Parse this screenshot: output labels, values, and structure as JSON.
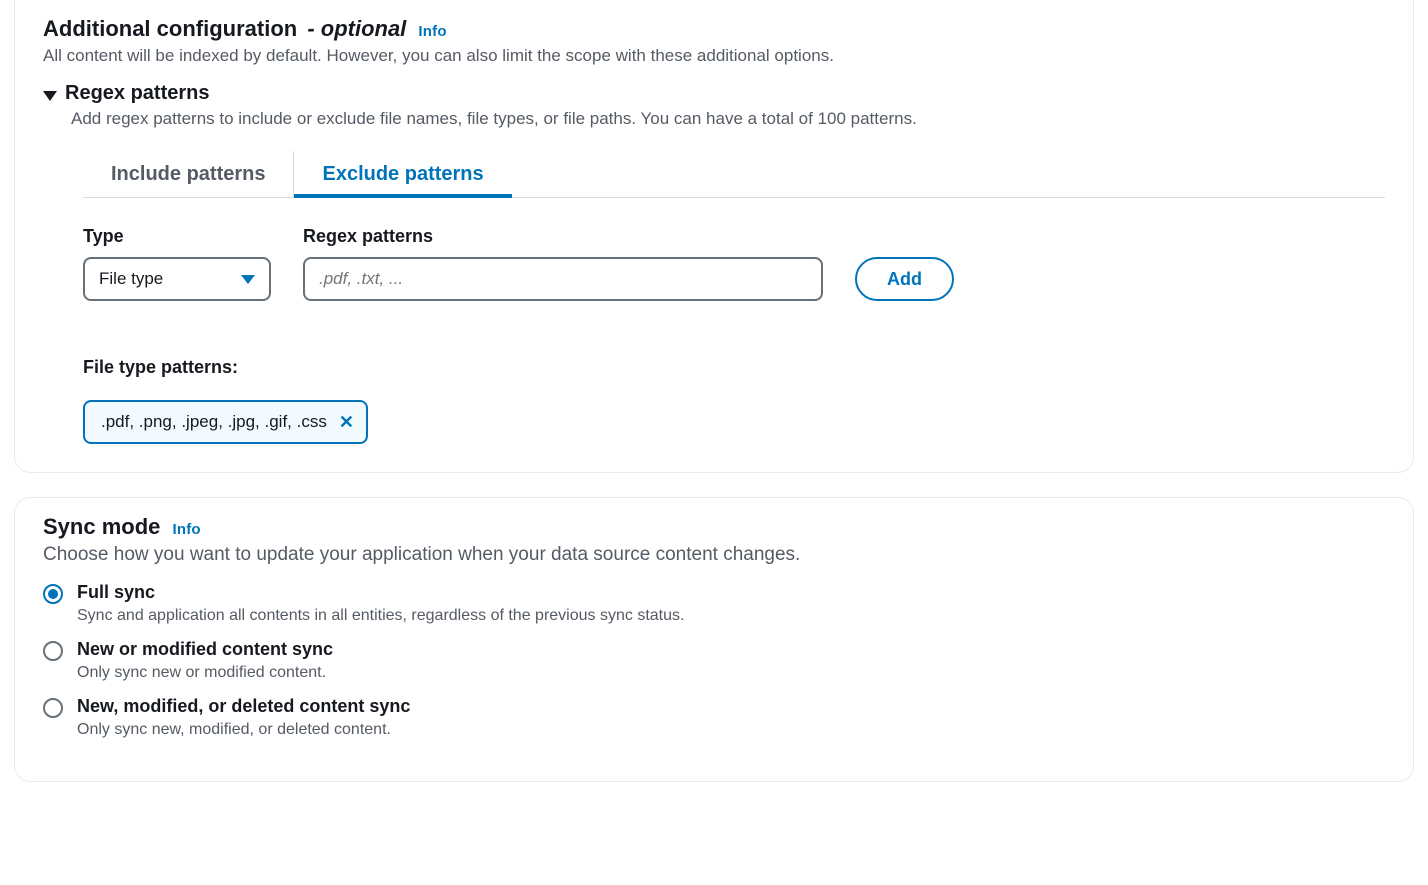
{
  "additional": {
    "title": "Additional configuration",
    "optional_suffix": " - optional",
    "info": "Info",
    "description": "All content will be indexed by default. However, you can also limit the scope with these additional options.",
    "regex": {
      "title": "Regex patterns",
      "description": "Add regex patterns to include or exclude file names, file types, or file paths. You can have a total of 100 patterns.",
      "tabs": {
        "include": "Include patterns",
        "exclude": "Exclude patterns"
      },
      "type_label": "Type",
      "type_value": "File type",
      "regex_label": "Regex patterns",
      "regex_placeholder": ".pdf, .txt, ...",
      "add_button": "Add",
      "existing_label": "File type patterns:",
      "token_value": ".pdf, .png, .jpeg, .jpg, .gif, .css"
    }
  },
  "sync": {
    "title": "Sync mode",
    "info": "Info",
    "description": "Choose how you want to update your application when your data source content changes.",
    "selected": "full",
    "options": [
      {
        "key": "full",
        "label": "Full sync",
        "desc": "Sync and application all contents in all entities, regardless of the previous sync status."
      },
      {
        "key": "new_modified",
        "label": "New or modified content sync",
        "desc": "Only sync new or modified content."
      },
      {
        "key": "new_modified_deleted",
        "label": "New, modified, or deleted content sync",
        "desc": "Only sync new, modified, or deleted content."
      }
    ]
  }
}
